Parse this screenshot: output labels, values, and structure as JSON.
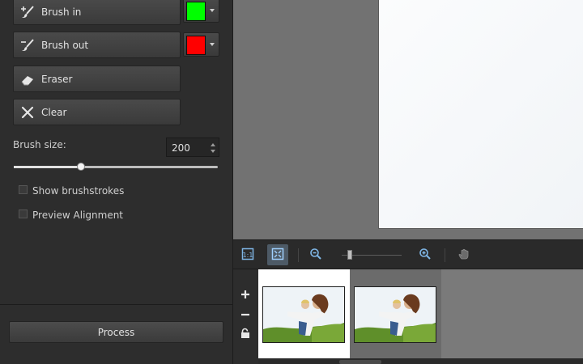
{
  "left_panel": {
    "brush_in": {
      "label": "Brush in",
      "color": "#00ff00",
      "icon": "brush-plus-icon"
    },
    "brush_out": {
      "label": "Brush out",
      "color": "#ff0000",
      "icon": "brush-minus-icon"
    },
    "eraser": {
      "label": "Eraser",
      "icon": "eraser-icon"
    },
    "clear": {
      "label": "Clear",
      "icon": "clear-x-icon"
    },
    "brush_size": {
      "label": "Brush size:",
      "value": "200",
      "slider_fraction": 0.33
    },
    "show_brushstrokes": {
      "label": "Show brushstrokes",
      "checked": false
    },
    "preview_alignment": {
      "label": "Preview Alignment",
      "checked": false
    },
    "process_label": "Process"
  },
  "toolbar": {
    "buttons": [
      "fit-view-icon",
      "actual-size-icon",
      "zoom-out-icon",
      "zoom-in-icon",
      "hand-pan-icon"
    ],
    "zoom_fraction": 0.1
  },
  "filmstrip": {
    "side_buttons": [
      "add-icon",
      "remove-icon",
      "lock-icon"
    ],
    "frames": [
      {
        "selected": true
      },
      {
        "selected": false
      }
    ]
  }
}
